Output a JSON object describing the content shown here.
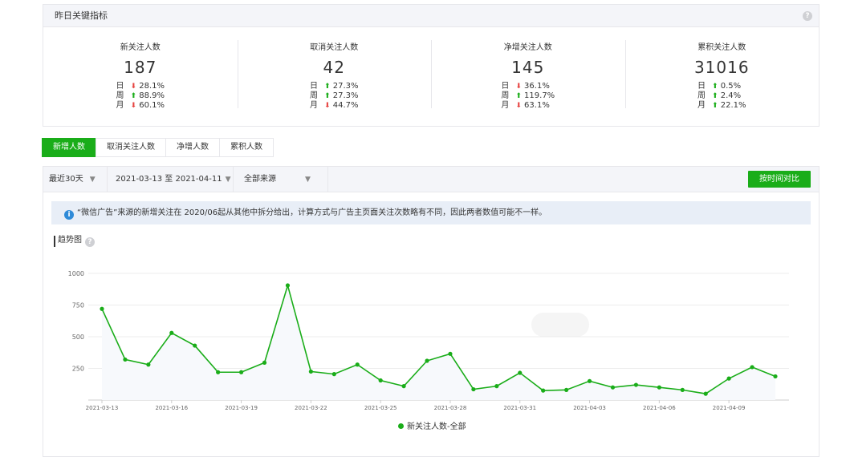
{
  "summary": {
    "title": "昨日关键指标",
    "help_icon": "help-icon",
    "kpis": [
      {
        "label": "新关注人数",
        "value": "187",
        "rows": [
          {
            "period": "日",
            "dir": "down",
            "pct": "28.1%"
          },
          {
            "period": "周",
            "dir": "up",
            "pct": "88.9%"
          },
          {
            "period": "月",
            "dir": "down",
            "pct": "60.1%"
          }
        ]
      },
      {
        "label": "取消关注人数",
        "value": "42",
        "rows": [
          {
            "period": "日",
            "dir": "up",
            "pct": "27.3%"
          },
          {
            "period": "周",
            "dir": "up",
            "pct": "27.3%"
          },
          {
            "period": "月",
            "dir": "down",
            "pct": "44.7%"
          }
        ]
      },
      {
        "label": "净增关注人数",
        "value": "145",
        "rows": [
          {
            "period": "日",
            "dir": "down",
            "pct": "36.1%"
          },
          {
            "period": "周",
            "dir": "up",
            "pct": "119.7%"
          },
          {
            "period": "月",
            "dir": "down",
            "pct": "63.1%"
          }
        ]
      },
      {
        "label": "累积关注人数",
        "value": "31016",
        "rows": [
          {
            "period": "日",
            "dir": "up",
            "pct": "0.5%"
          },
          {
            "period": "周",
            "dir": "up",
            "pct": "2.4%"
          },
          {
            "period": "月",
            "dir": "up",
            "pct": "22.1%"
          }
        ]
      }
    ]
  },
  "tabs": [
    "新增人数",
    "取消关注人数",
    "净增人数",
    "累积人数"
  ],
  "filters": {
    "range": "最近30天",
    "dates": "2021-03-13 至 2021-04-11",
    "source": "全部来源",
    "compare_button": "按时间对比"
  },
  "notice": "“微信广告”来源的新增关注在 2020/06起从其他中拆分给出，计算方式与广告主页面关注次数略有不同，因此两者数值可能不一样。",
  "trend_title": "趋势图",
  "colors": {
    "accent": "#1aad19",
    "down": "#e64340",
    "info": "#2e8ad8"
  },
  "chart_data": {
    "type": "line",
    "title": "",
    "xlabel": "",
    "ylabel": "",
    "x": [
      "2021-03-13",
      "2021-03-14",
      "2021-03-15",
      "2021-03-16",
      "2021-03-17",
      "2021-03-18",
      "2021-03-19",
      "2021-03-20",
      "2021-03-21",
      "2021-03-22",
      "2021-03-23",
      "2021-03-24",
      "2021-03-25",
      "2021-03-26",
      "2021-03-27",
      "2021-03-28",
      "2021-03-29",
      "2021-03-30",
      "2021-03-31",
      "2021-04-01",
      "2021-04-02",
      "2021-04-03",
      "2021-04-04",
      "2021-04-05",
      "2021-04-06",
      "2021-04-07",
      "2021-04-08",
      "2021-04-09",
      "2021-04-10",
      "2021-04-11"
    ],
    "x_tick_labels": [
      "2021-03-13",
      "2021-03-16",
      "2021-03-19",
      "2021-03-22",
      "2021-03-25",
      "2021-03-28",
      "2021-03-31",
      "2021-04-03",
      "2021-04-06",
      "2021-04-09"
    ],
    "series": [
      {
        "name": "新关注人数-全部",
        "values": [
          720,
          320,
          280,
          530,
          430,
          220,
          220,
          295,
          905,
          225,
          205,
          280,
          155,
          110,
          310,
          365,
          85,
          110,
          215,
          75,
          80,
          150,
          100,
          120,
          100,
          80,
          50,
          170,
          260,
          187
        ]
      }
    ],
    "y_ticks": [
      250,
      500,
      750,
      1000
    ],
    "ylim": [
      0,
      1000
    ],
    "grid": true,
    "legend": "bottom-center"
  }
}
